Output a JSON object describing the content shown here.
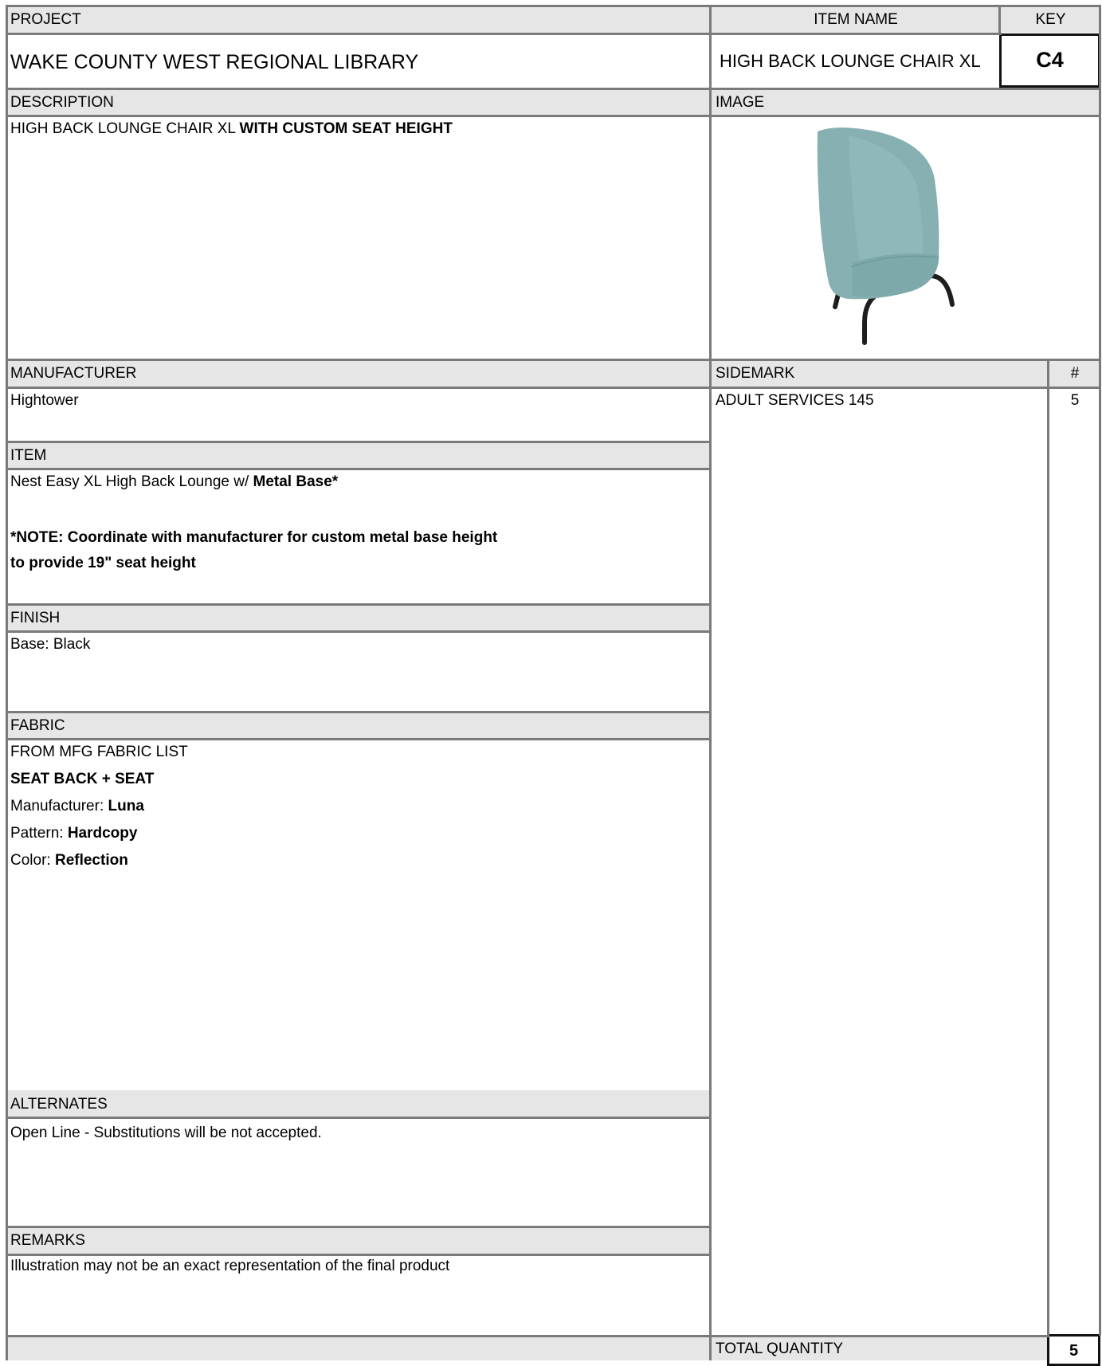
{
  "header": {
    "project_label": "PROJECT",
    "item_name_label": "ITEM NAME",
    "key_label": "KEY",
    "project_value": "WAKE COUNTY WEST REGIONAL LIBRARY",
    "item_name_value": "HIGH BACK LOUNGE CHAIR XL",
    "key_value": "C4"
  },
  "description": {
    "label": "DESCRIPTION",
    "text_plain": "HIGH BACK LOUNGE CHAIR XL ",
    "text_bold": "WITH CUSTOM SEAT HEIGHT"
  },
  "image": {
    "label": "IMAGE",
    "icon": "lounge-chair-icon",
    "chair_color": "#86b0b2",
    "leg_color": "#1e1e1e"
  },
  "manufacturer": {
    "label": "MANUFACTURER",
    "value": "Hightower"
  },
  "sidemark": {
    "label": "SIDEMARK",
    "count_label": "#",
    "value": "ADULT SERVICES 145",
    "count": "5"
  },
  "item": {
    "label": "ITEM",
    "line1_plain": "Nest Easy XL High Back Lounge w/ ",
    "line1_bold": "Metal Base*",
    "note_line1": "*NOTE: Coordinate with manufacturer for custom metal base height",
    "note_line2": "to provide 19\" seat height"
  },
  "finish": {
    "label": "FINISH",
    "value": "Base: Black"
  },
  "fabric": {
    "label": "FABRIC",
    "line1": "FROM MFG FABRIC LIST",
    "line2": "SEAT BACK + SEAT",
    "manufacturer_label": "Manufacturer: ",
    "manufacturer_value": "Luna",
    "pattern_label": "Pattern: ",
    "pattern_value": "Hardcopy",
    "color_label": "Color: ",
    "color_value": "Reflection"
  },
  "alternates": {
    "label": "ALTERNATES",
    "value": "Open Line - Substitutions will be not accepted."
  },
  "remarks": {
    "label": "REMARKS",
    "value": "Illustration may not be an exact representation of the final product"
  },
  "total": {
    "label": "TOTAL QUANTITY",
    "value": "5"
  },
  "colors": {
    "header_bg": "#e6e6e6",
    "grid_line": "#7a7a7a"
  }
}
